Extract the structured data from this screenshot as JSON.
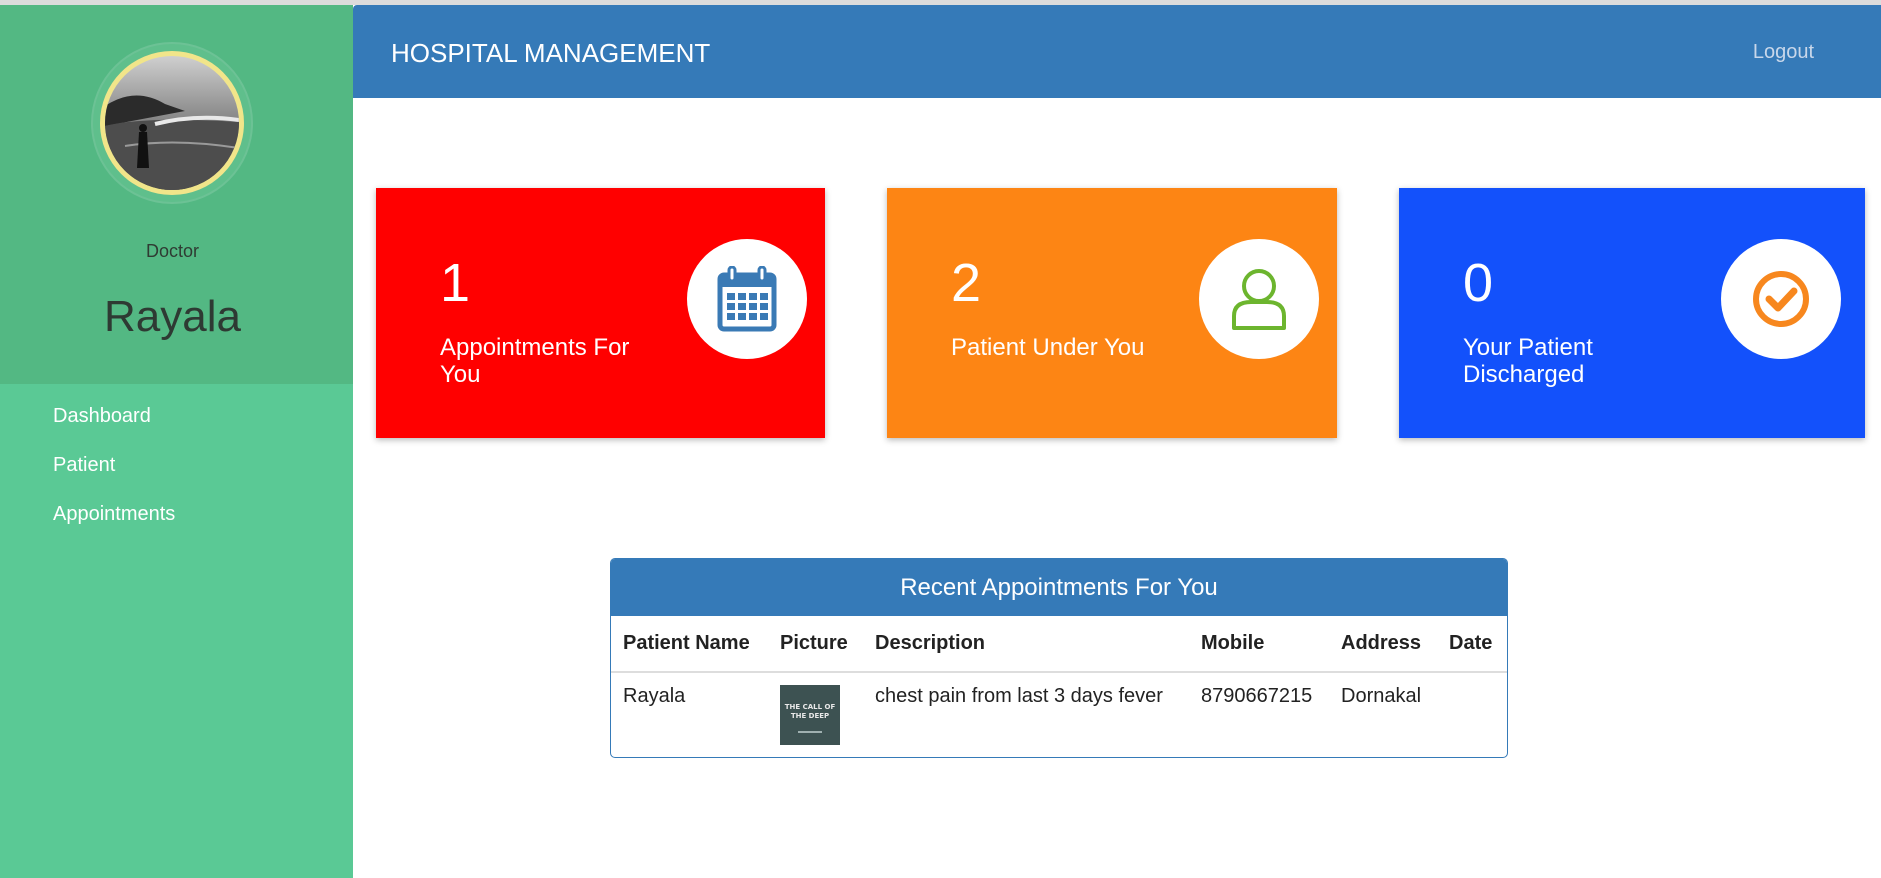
{
  "sidebar": {
    "role": "Doctor",
    "name": "Rayala",
    "nav": [
      {
        "label": "Dashboard"
      },
      {
        "label": "Patient"
      },
      {
        "label": "Appointments"
      }
    ]
  },
  "header": {
    "title": "HOSPITAL MANAGEMENT",
    "logout": "Logout"
  },
  "cards": [
    {
      "count": "1",
      "label": "Appointments For You",
      "icon": "calendar-icon",
      "color": "#ff0000"
    },
    {
      "count": "2",
      "label": "Patient Under You",
      "icon": "user-icon",
      "color": "#fd8514"
    },
    {
      "count": "0",
      "label": "Your Patient Discharged",
      "icon": "check-circle-icon",
      "color": "#1351fb"
    }
  ],
  "appointments": {
    "title": "Recent Appointments For You",
    "columns": [
      "Patient Name",
      "Picture",
      "Description",
      "Mobile",
      "Address",
      "Date"
    ],
    "rows": [
      {
        "patient_name": "Rayala",
        "picture_text": "THE CALL OF THE DEEP",
        "description": "chest pain from last 3 days fever",
        "mobile": "8790667215",
        "address": "Dornakal",
        "date": ""
      }
    ]
  },
  "colors": {
    "sidebar": "#5ac995",
    "profile_bg": "#53b883",
    "header": "#357ab8"
  }
}
